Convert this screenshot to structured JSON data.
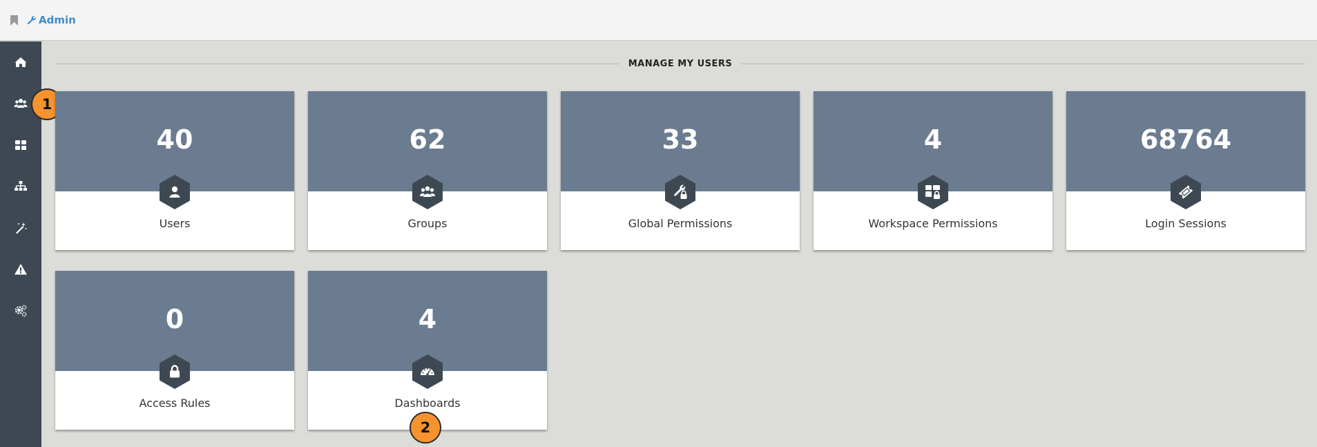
{
  "header": {
    "breadcrumb_label": "Admin"
  },
  "sidebar": {
    "items": [
      {
        "icon": "home-icon"
      },
      {
        "icon": "users-icon"
      },
      {
        "icon": "grid-icon"
      },
      {
        "icon": "sitemap-icon"
      },
      {
        "icon": "magic-wand-icon"
      },
      {
        "icon": "warning-icon"
      },
      {
        "icon": "cogs-icon"
      }
    ]
  },
  "callouts": [
    "1",
    "2"
  ],
  "section": {
    "title": "MANAGE MY USERS"
  },
  "cards": [
    {
      "count": "40",
      "label": "Users",
      "icon": "user-icon"
    },
    {
      "count": "62",
      "label": "Groups",
      "icon": "users-icon"
    },
    {
      "count": "33",
      "label": "Global Permissions",
      "icon": "wrench-lock-icon"
    },
    {
      "count": "4",
      "label": "Workspace Permissions",
      "icon": "grid-lock-icon"
    },
    {
      "count": "68764",
      "label": "Login Sessions",
      "icon": "ticket-icon"
    },
    {
      "count": "0",
      "label": "Access Rules",
      "icon": "lock-icon"
    },
    {
      "count": "4",
      "label": "Dashboards",
      "icon": "dashboard-icon"
    }
  ],
  "colors": {
    "accent_link": "#3d8fd0",
    "sidebar_bg": "#3d4852",
    "card_top": "#6b7c91",
    "hex_bg": "#3d4852",
    "callout": "#f6932e"
  }
}
